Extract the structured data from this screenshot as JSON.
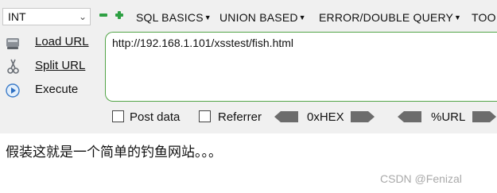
{
  "type_select": {
    "value": "INT"
  },
  "menu": [
    {
      "label": "SQL BASICS"
    },
    {
      "label": "UNION BASED"
    },
    {
      "label": "ERROR/DOUBLE QUERY"
    },
    {
      "label": "TOO"
    }
  ],
  "actions": {
    "load": {
      "label": "Load URL",
      "icon": "load-url-icon"
    },
    "split": {
      "label": "Split URL",
      "icon": "scissors-icon"
    },
    "execute": {
      "label": "Execute",
      "icon": "play-icon"
    }
  },
  "url": {
    "value": "http://192.168.1.101/xsstest/fish.html"
  },
  "options": {
    "post_data": {
      "label": "Post data",
      "checked": false
    },
    "referrer": {
      "label": "Referrer",
      "checked": false
    },
    "hex": {
      "label": "0xHEX"
    },
    "urlenc": {
      "label": "%URL"
    }
  },
  "page": {
    "text": "假装这就是一个简单的钓鱼网站。。。"
  },
  "watermark": {
    "text": "CSDN @Fenizal"
  },
  "colors": {
    "accent_green": "#2ea043",
    "url_border": "#52a447",
    "toolbar_bg": "#f0f0f0"
  }
}
